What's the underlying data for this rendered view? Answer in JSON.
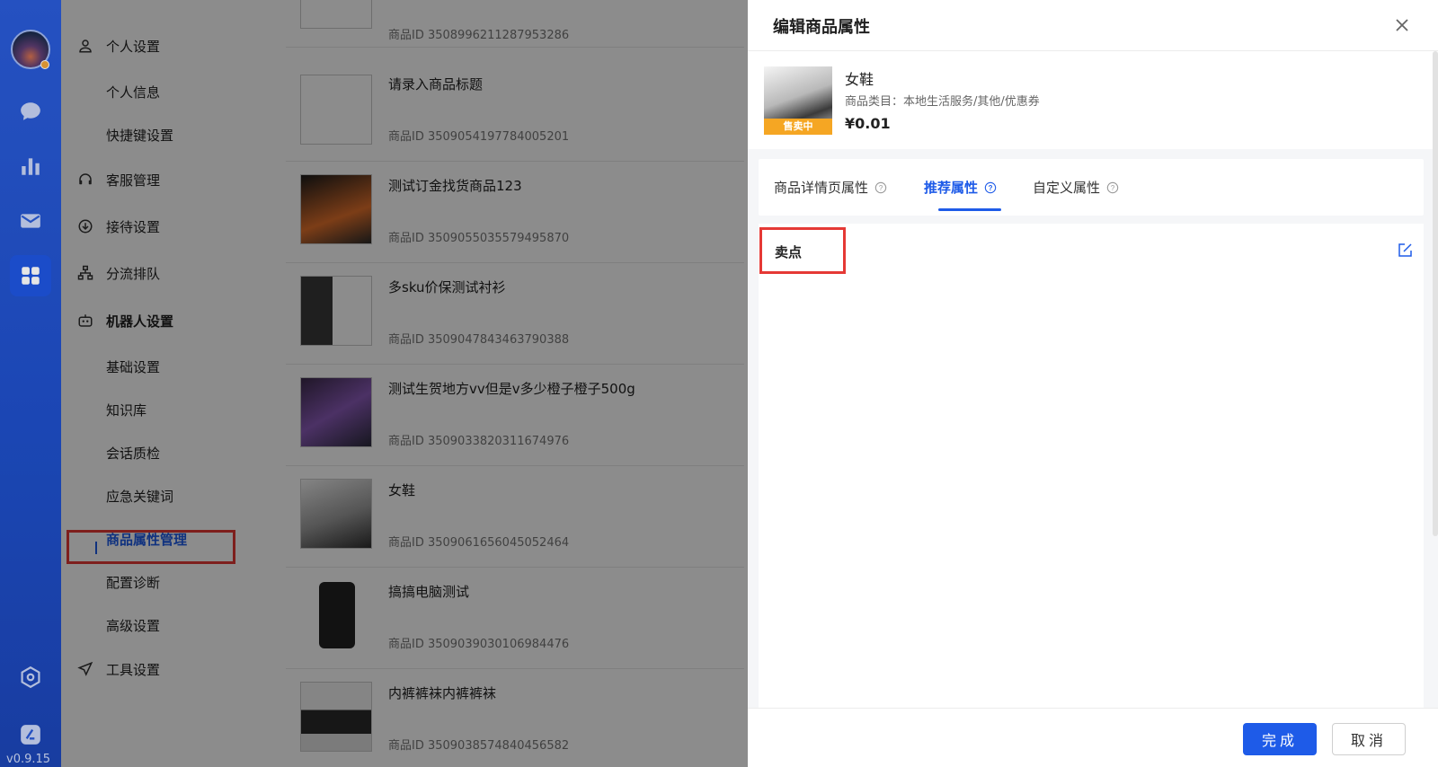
{
  "app": {
    "version": "v0.9.15"
  },
  "rail": {
    "icons": [
      "chat-icon",
      "chart-icon",
      "mail-icon",
      "apps-icon",
      "settings-icon",
      "brand-icon"
    ]
  },
  "menu": {
    "personal": {
      "label": "个人设置",
      "items": [
        "个人信息",
        "快捷键设置"
      ]
    },
    "service": {
      "label": "客服管理"
    },
    "reception": {
      "label": "接待设置"
    },
    "queue": {
      "label": "分流排队"
    },
    "robot": {
      "label": "机器人设置",
      "items": [
        "基础设置",
        "知识库",
        "会话质检",
        "应急关键词",
        "商品属性管理",
        "配置诊断",
        "高级设置"
      ]
    },
    "tools": {
      "label": "工具设置"
    }
  },
  "list": {
    "items": [
      {
        "title": "",
        "id": "商品ID 3508996211287953286"
      },
      {
        "title": "请录入商品标题",
        "id": "商品ID 3509054197784005201"
      },
      {
        "title": "测试订金找货商品123",
        "id": "商品ID 3509055035579495870"
      },
      {
        "title": "多sku价保测试衬衫",
        "id": "商品ID 3509047843463790388"
      },
      {
        "title": "测试生贺地方vv但是v多少橙子橙子500g",
        "id": "商品ID 3509033820311674976"
      },
      {
        "title": "女鞋",
        "id": "商品ID 3509061656045052464"
      },
      {
        "title": "搞搞电脑测试",
        "id": "商品ID 3509039030106984476"
      },
      {
        "title": "内裤裤袜内裤裤袜",
        "id": "商品ID 3509038574840456582"
      }
    ]
  },
  "drawer": {
    "title": "编辑商品属性",
    "product": {
      "name": "女鞋",
      "category": "商品类目：本地生活服务/其他/优惠券",
      "price": "¥0.01",
      "badge": "售卖中"
    },
    "tabs": [
      "商品详情页属性",
      "推荐属性",
      "自定义属性"
    ],
    "active_tab": "推荐属性",
    "section_label": "卖点",
    "buttons": {
      "ok": "完成",
      "cancel": "取消"
    }
  },
  "colors": {
    "accent": "#1e5be8",
    "highlight": "#e53935",
    "badge": "#f5a623"
  }
}
